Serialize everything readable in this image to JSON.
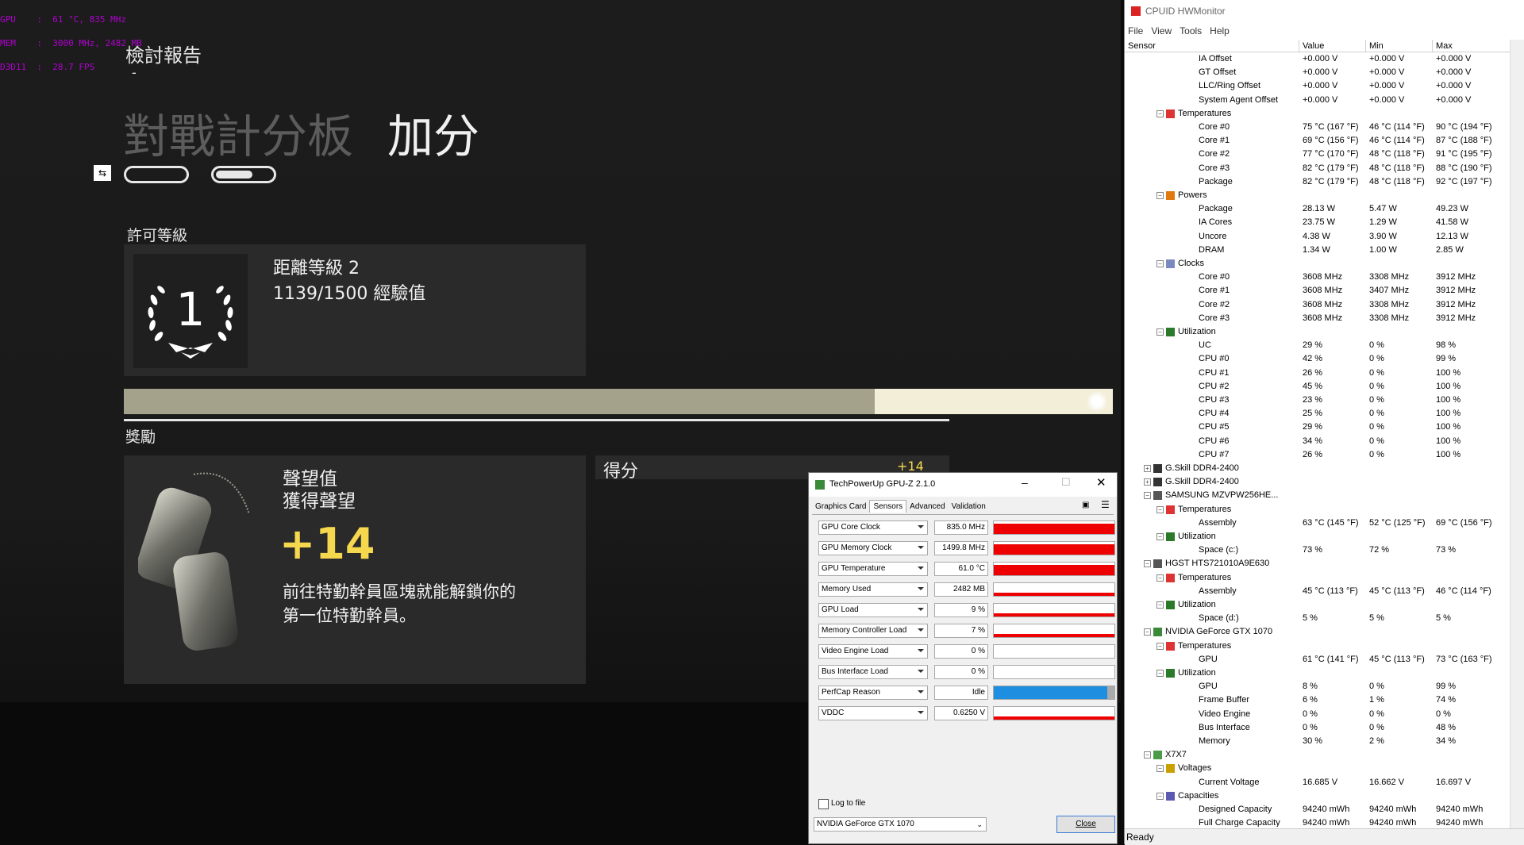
{
  "osd": {
    "lines": [
      "GPU    :  61 °C, 835 MHz",
      "MEM    :  3000 MHz, 2482 MB",
      "D3D11  :  28.7 FPS"
    ]
  },
  "game": {
    "header": "檢討報告",
    "header_dash": "-",
    "scoreboard_label": "對戰計分板",
    "bonus_label": "加分",
    "license_title": "許可等級",
    "rank_number": "1",
    "next_level": "距離等級 2",
    "xp": "1139/1500 經驗值",
    "xp_progress": 0.759,
    "rewards_title": "獎勵",
    "renown_title": "聲望值",
    "renown_subtitle": "獲得聲望",
    "renown_amount": "+14",
    "renown_desc_1": "前往特勤幹員區塊就能解鎖你的",
    "renown_desc_2": "第一位特勤幹員。",
    "score_title": "得分",
    "score_bonus": "+14"
  },
  "gpuz": {
    "title": "TechPowerUp GPU-Z 2.1.0",
    "tabs": [
      "Graphics Card",
      "Sensors",
      "Advanced",
      "Validation"
    ],
    "active_tab": "Sensors",
    "sensors": [
      {
        "name": "GPU Core Clock",
        "value": "835.0 MHz",
        "graph": "red-high"
      },
      {
        "name": "GPU Memory Clock",
        "value": "1499.8 MHz",
        "graph": "red-high"
      },
      {
        "name": "GPU Temperature",
        "value": "61.0 °C",
        "graph": "red-high"
      },
      {
        "name": "Memory Used",
        "value": "2482 MB",
        "graph": "red-low"
      },
      {
        "name": "GPU Load",
        "value": "9 %",
        "graph": "red-low"
      },
      {
        "name": "Memory Controller Load",
        "value": "7 %",
        "graph": "red-low"
      },
      {
        "name": "Video Engine Load",
        "value": "0 %",
        "graph": "empty"
      },
      {
        "name": "Bus Interface Load",
        "value": "0 %",
        "graph": "empty"
      },
      {
        "name": "PerfCap Reason",
        "value": "Idle",
        "graph": "blue"
      },
      {
        "name": "VDDC",
        "value": "0.6250 V",
        "graph": "red-low"
      }
    ],
    "log_to_file": "Log to file",
    "device": "NVIDIA GeForce GTX 1070",
    "close_button": "Close",
    "colors": {
      "graph_red": "#ee0000",
      "graph_blue": "#1e8fe0"
    }
  },
  "hwmonitor": {
    "title": "CPUID HWMonitor",
    "menu": [
      "File",
      "View",
      "Tools",
      "Help"
    ],
    "columns": [
      "Sensor",
      "Value",
      "Min",
      "Max"
    ],
    "status": "Ready",
    "rows": [
      {
        "level": 3,
        "type": "item",
        "label": "IA Offset",
        "value": "+0.000 V",
        "min": "+0.000 V",
        "max": "+0.000 V"
      },
      {
        "level": 3,
        "type": "item",
        "label": "GT Offset",
        "value": "+0.000 V",
        "min": "+0.000 V",
        "max": "+0.000 V"
      },
      {
        "level": 3,
        "type": "item",
        "label": "LLC/Ring Offset",
        "value": "+0.000 V",
        "min": "+0.000 V",
        "max": "+0.000 V"
      },
      {
        "level": 3,
        "type": "item",
        "label": "System Agent Offset",
        "value": "+0.000 V",
        "min": "+0.000 V",
        "max": "+0.000 V"
      },
      {
        "level": 2,
        "type": "group",
        "icon": "thermometer-icon",
        "label": "Temperatures"
      },
      {
        "level": 3,
        "type": "item",
        "label": "Core #0",
        "value": "75 °C  (167 °F)",
        "min": "46 °C  (114 °F)",
        "max": "90 °C  (194 °F)"
      },
      {
        "level": 3,
        "type": "item",
        "label": "Core #1",
        "value": "69 °C  (156 °F)",
        "min": "46 °C  (114 °F)",
        "max": "87 °C  (188 °F)"
      },
      {
        "level": 3,
        "type": "item",
        "label": "Core #2",
        "value": "77 °C  (170 °F)",
        "min": "48 °C  (118 °F)",
        "max": "91 °C  (195 °F)"
      },
      {
        "level": 3,
        "type": "item",
        "label": "Core #3",
        "value": "82 °C  (179 °F)",
        "min": "48 °C  (118 °F)",
        "max": "88 °C  (190 °F)"
      },
      {
        "level": 3,
        "type": "item",
        "label": "Package",
        "value": "82 °C  (179 °F)",
        "min": "48 °C  (118 °F)",
        "max": "92 °C  (197 °F)"
      },
      {
        "level": 2,
        "type": "group",
        "icon": "power-icon",
        "label": "Powers"
      },
      {
        "level": 3,
        "type": "item",
        "label": "Package",
        "value": "28.13 W",
        "min": "5.47 W",
        "max": "49.23 W"
      },
      {
        "level": 3,
        "type": "item",
        "label": "IA Cores",
        "value": "23.75 W",
        "min": "1.29 W",
        "max": "41.58 W"
      },
      {
        "level": 3,
        "type": "item",
        "label": "Uncore",
        "value": "4.38 W",
        "min": "3.90 W",
        "max": "12.13 W"
      },
      {
        "level": 3,
        "type": "item",
        "label": "DRAM",
        "value": "1.34 W",
        "min": "1.00 W",
        "max": "2.85 W"
      },
      {
        "level": 2,
        "type": "group",
        "icon": "clock-icon",
        "label": "Clocks"
      },
      {
        "level": 3,
        "type": "item",
        "label": "Core #0",
        "value": "3608 MHz",
        "min": "3308 MHz",
        "max": "3912 MHz"
      },
      {
        "level": 3,
        "type": "item",
        "label": "Core #1",
        "value": "3608 MHz",
        "min": "3407 MHz",
        "max": "3912 MHz"
      },
      {
        "level": 3,
        "type": "item",
        "label": "Core #2",
        "value": "3608 MHz",
        "min": "3308 MHz",
        "max": "3912 MHz"
      },
      {
        "level": 3,
        "type": "item",
        "label": "Core #3",
        "value": "3608 MHz",
        "min": "3308 MHz",
        "max": "3912 MHz"
      },
      {
        "level": 2,
        "type": "group",
        "icon": "utilization-icon",
        "label": "Utilization"
      },
      {
        "level": 3,
        "type": "item",
        "label": "UC",
        "value": "29 %",
        "min": "0 %",
        "max": "98 %"
      },
      {
        "level": 3,
        "type": "item",
        "label": "CPU #0",
        "value": "42 %",
        "min": "0 %",
        "max": "99 %"
      },
      {
        "level": 3,
        "type": "item",
        "label": "CPU #1",
        "value": "26 %",
        "min": "0 %",
        "max": "100 %"
      },
      {
        "level": 3,
        "type": "item",
        "label": "CPU #2",
        "value": "45 %",
        "min": "0 %",
        "max": "100 %"
      },
      {
        "level": 3,
        "type": "item",
        "label": "CPU #3",
        "value": "23 %",
        "min": "0 %",
        "max": "100 %"
      },
      {
        "level": 3,
        "type": "item",
        "label": "CPU #4",
        "value": "25 %",
        "min": "0 %",
        "max": "100 %"
      },
      {
        "level": 3,
        "type": "item",
        "label": "CPU #5",
        "value": "29 %",
        "min": "0 %",
        "max": "100 %"
      },
      {
        "level": 3,
        "type": "item",
        "label": "CPU #6",
        "value": "34 %",
        "min": "0 %",
        "max": "100 %"
      },
      {
        "level": 3,
        "type": "item",
        "label": "CPU #7",
        "value": "26 %",
        "min": "0 %",
        "max": "100 %"
      },
      {
        "level": 1,
        "type": "device",
        "collapsed": true,
        "icon": "memory-icon",
        "label": "G.Skill DDR4-2400"
      },
      {
        "level": 1,
        "type": "device",
        "collapsed": true,
        "icon": "memory-icon",
        "label": "G.Skill DDR4-2400"
      },
      {
        "level": 1,
        "type": "device",
        "icon": "drive-icon",
        "label": "SAMSUNG MZVPW256HE..."
      },
      {
        "level": 2,
        "type": "group",
        "icon": "thermometer-icon",
        "label": "Temperatures"
      },
      {
        "level": 3,
        "type": "item",
        "label": "Assembly",
        "value": "63 °C  (145 °F)",
        "min": "52 °C  (125 °F)",
        "max": "69 °C  (156 °F)"
      },
      {
        "level": 2,
        "type": "group",
        "icon": "utilization-icon",
        "label": "Utilization"
      },
      {
        "level": 3,
        "type": "item",
        "label": "Space (c:)",
        "value": "73 %",
        "min": "72 %",
        "max": "73 %"
      },
      {
        "level": 1,
        "type": "device",
        "icon": "drive-icon",
        "label": "HGST HTS721010A9E630"
      },
      {
        "level": 2,
        "type": "group",
        "icon": "thermometer-icon",
        "label": "Temperatures"
      },
      {
        "level": 3,
        "type": "item",
        "label": "Assembly",
        "value": "45 °C  (113 °F)",
        "min": "45 °C  (113 °F)",
        "max": "46 °C  (114 °F)"
      },
      {
        "level": 2,
        "type": "group",
        "icon": "utilization-icon",
        "label": "Utilization"
      },
      {
        "level": 3,
        "type": "item",
        "label": "Space (d:)",
        "value": "5 %",
        "min": "5 %",
        "max": "5 %"
      },
      {
        "level": 1,
        "type": "device",
        "icon": "gpu-icon",
        "label": "NVIDIA GeForce GTX 1070"
      },
      {
        "level": 2,
        "type": "group",
        "icon": "thermometer-icon",
        "label": "Temperatures"
      },
      {
        "level": 3,
        "type": "item",
        "label": "GPU",
        "value": "61 °C  (141 °F)",
        "min": "45 °C  (113 °F)",
        "max": "73 °C  (163 °F)"
      },
      {
        "level": 2,
        "type": "group",
        "icon": "utilization-icon",
        "label": "Utilization"
      },
      {
        "level": 3,
        "type": "item",
        "label": "GPU",
        "value": "8 %",
        "min": "0 %",
        "max": "99 %"
      },
      {
        "level": 3,
        "type": "item",
        "label": "Frame Buffer",
        "value": "6 %",
        "min": "1 %",
        "max": "74 %"
      },
      {
        "level": 3,
        "type": "item",
        "label": "Video Engine",
        "value": "0 %",
        "min": "0 %",
        "max": "0 %"
      },
      {
        "level": 3,
        "type": "item",
        "label": "Bus Interface",
        "value": "0 %",
        "min": "0 %",
        "max": "48 %"
      },
      {
        "level": 3,
        "type": "item",
        "label": "Memory",
        "value": "30 %",
        "min": "2 %",
        "max": "34 %"
      },
      {
        "level": 1,
        "type": "device",
        "icon": "battery-icon",
        "label": "X7X7"
      },
      {
        "level": 2,
        "type": "group",
        "icon": "voltage-icon",
        "label": "Voltages"
      },
      {
        "level": 3,
        "type": "item",
        "label": "Current Voltage",
        "value": "16.685 V",
        "min": "16.662 V",
        "max": "16.697 V"
      },
      {
        "level": 2,
        "type": "group",
        "icon": "capacity-icon",
        "label": "Capacities"
      },
      {
        "level": 3,
        "type": "item",
        "label": "Designed Capacity",
        "value": "94240 mWh",
        "min": "94240 mWh",
        "max": "94240 mWh"
      },
      {
        "level": 3,
        "type": "item",
        "label": "Full Charge Capacity",
        "value": "94240 mWh",
        "min": "94240 mWh",
        "max": "94240 mWh"
      }
    ]
  }
}
